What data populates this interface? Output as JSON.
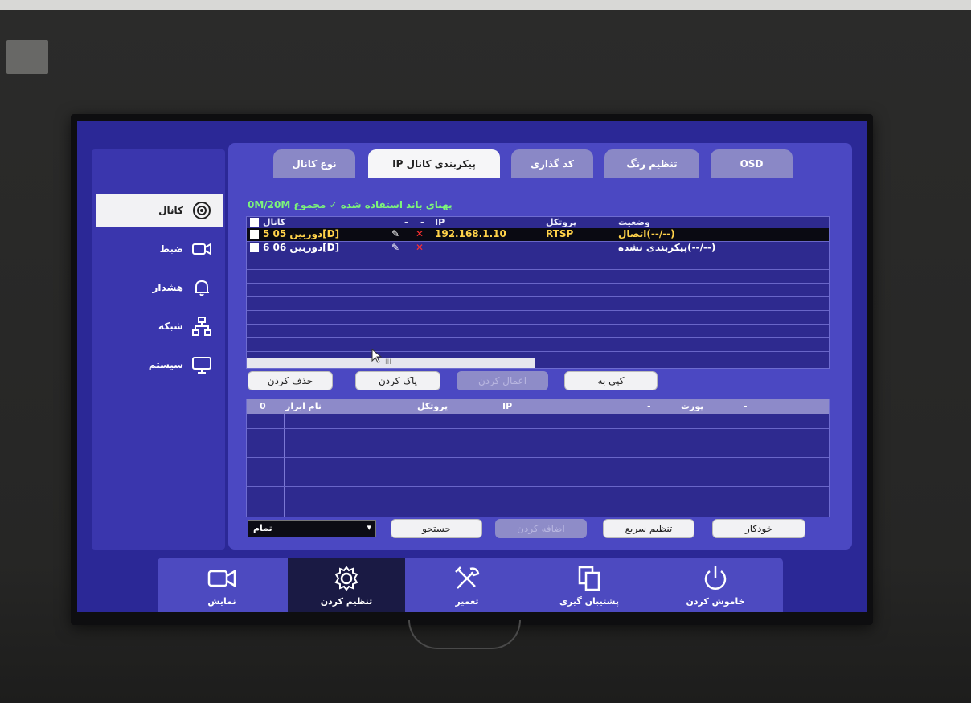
{
  "sidebar": {
    "items": [
      {
        "label": "کانال",
        "icon": "camera-icon"
      },
      {
        "label": "ضبط",
        "icon": "video-camera-icon"
      },
      {
        "label": "هشدار",
        "icon": "bell-icon"
      },
      {
        "label": "شبکه",
        "icon": "network-icon"
      },
      {
        "label": "سیستم",
        "icon": "monitor-icon"
      }
    ]
  },
  "tabs": [
    "نوع کانال",
    "IP پیکربندی کانال",
    "کد گذاری",
    "تنظیم رنگ",
    "OSD"
  ],
  "bandwidth": "0M/20M پهنای باند استفاده شده ✓ مجموع",
  "channel_table": {
    "headers": {
      "channel": "کانال",
      "dash1": "-",
      "dash2": "-",
      "ip": "IP",
      "protocol": "پروتکل",
      "status": "وضعیت"
    },
    "rows": [
      {
        "channel": "5 دوربین 05[D]",
        "ip": "192.168.1.10",
        "protocol": "RTSP",
        "status": "اتصال(--/--)"
      },
      {
        "channel": "6 دوربین 06[D]",
        "ip": "",
        "protocol": "",
        "status": "پیکربندی نشده(--/--)"
      }
    ],
    "scroll_mark": "III"
  },
  "buttons1": {
    "delete": "حذف کردن",
    "clear": "پاک کردن",
    "disabled_btn": "اعمال کردن",
    "copy": "کپی به"
  },
  "device_table": {
    "headers": {
      "count": "0",
      "device_name": "نام ابزار",
      "protocol": "پروتکل",
      "ip": "IP",
      "port_dash": "-",
      "port": "پورت",
      "dash": "-"
    }
  },
  "filter": {
    "value": "تمام",
    "arrow": "▾"
  },
  "buttons2": {
    "search": "جستجو",
    "disabled_btn": "اضافه کردن",
    "quick_setup": "تنظیم سریع",
    "auto": "خودکار"
  },
  "dock": [
    {
      "label": "نمایش",
      "icon": "video-camera-icon"
    },
    {
      "label": "تنظیم کردن",
      "icon": "gear-icon"
    },
    {
      "label": "تعمیر",
      "icon": "tools-icon"
    },
    {
      "label": "پشتیبان گیری",
      "icon": "copy-icon"
    },
    {
      "label": "خاموش کردن",
      "icon": "power-icon"
    }
  ],
  "colors": {
    "screen_bg": "#2b2896",
    "panel_bg": "#4b48c2",
    "selected_text": "#ffd24a",
    "bandwidth_text": "#7cf47a",
    "delete_x": "#ff3030"
  }
}
